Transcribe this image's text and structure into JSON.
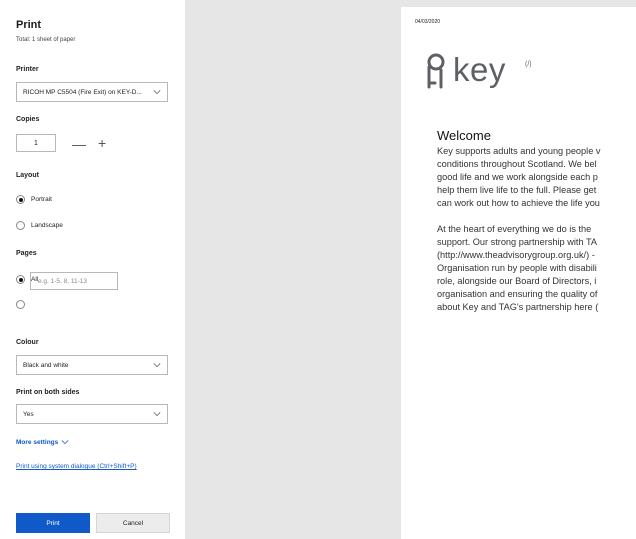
{
  "panel": {
    "title": "Print",
    "subtitle": "Total: 1 sheet of paper",
    "printer": {
      "label": "Printer",
      "value": "RICOH MP C5504 (Fire Exit) on KEY-D..."
    },
    "copies": {
      "label": "Copies",
      "value": "1",
      "decrement": "—",
      "increment": "+"
    },
    "layout": {
      "label": "Layout",
      "options": [
        "Portrait",
        "Landscape"
      ],
      "selected": "Portrait"
    },
    "pages": {
      "label": "Pages",
      "option_all": "All",
      "range_placeholder": "e.g. 1-5, 8, 11-13",
      "selected": "All"
    },
    "colour": {
      "label": "Colour",
      "value": "Black and white"
    },
    "duplex": {
      "label": "Print on both sides",
      "value": "Yes"
    },
    "more_settings": "More settings",
    "system_dialogue": "Print using system dialogue (Ctrl+Shift+P)",
    "print_button": "Print",
    "cancel_button": "Cancel"
  },
  "preview": {
    "date": "04/03/2020",
    "logo_text": "key",
    "logo_sup": "(/)",
    "heading": "Welcome",
    "paragraph1": [
      "Key supports adults and young people v",
      "conditions throughout Scotland. We bel",
      "good life and we work alongside each p",
      "help them live life to the full. Please get",
      "can work out how to achieve the life you"
    ],
    "paragraph2": [
      "At the heart of everything we do is the",
      "support. Our strong partnership with TA",
      "(http://www.theadvisorygroup.org.uk/) -",
      "Organisation run by people with disabili",
      "role, alongside our Board of Directors, i",
      "organisation and ensuring the quality of",
      "about Key and TAG's partnership here ("
    ]
  },
  "colors": {
    "accent": "#0f5ac8",
    "logo": "#5d6065"
  },
  "icons": {
    "dropdown": "chevron-down-icon",
    "logo": "key-logo-icon"
  }
}
